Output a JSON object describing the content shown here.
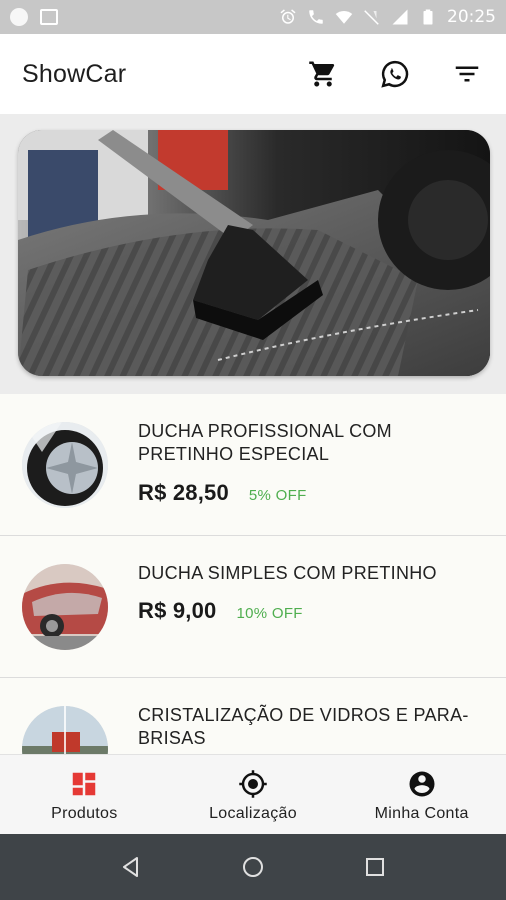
{
  "status_bar": {
    "time": "20:25"
  },
  "app_bar": {
    "title": "ShowCar",
    "icons": [
      "cart-icon",
      "whatsapp-icon",
      "filter-icon"
    ]
  },
  "products": [
    {
      "name": "DUCHA PROFISSIONAL COM PRETINHO ESPECIAL",
      "price": "R$ 28,50",
      "discount": "5% OFF"
    },
    {
      "name": "DUCHA SIMPLES COM PRETINHO",
      "price": "R$ 9,00",
      "discount": "10% OFF"
    },
    {
      "name": "CRISTALIZAÇÃO DE VIDROS E PARA-BRISAS",
      "price": "",
      "discount": ""
    }
  ],
  "bottom_nav": {
    "items": [
      {
        "label": "Produtos",
        "icon": "dashboard-icon",
        "active": true
      },
      {
        "label": "Localização",
        "icon": "location-icon",
        "active": false
      },
      {
        "label": "Minha Conta",
        "icon": "account-icon",
        "active": false
      }
    ]
  },
  "colors": {
    "accent": "#e53935",
    "discount": "#4fae4f",
    "status_bar": "#c7c7c7",
    "system_nav": "#3f4448"
  }
}
